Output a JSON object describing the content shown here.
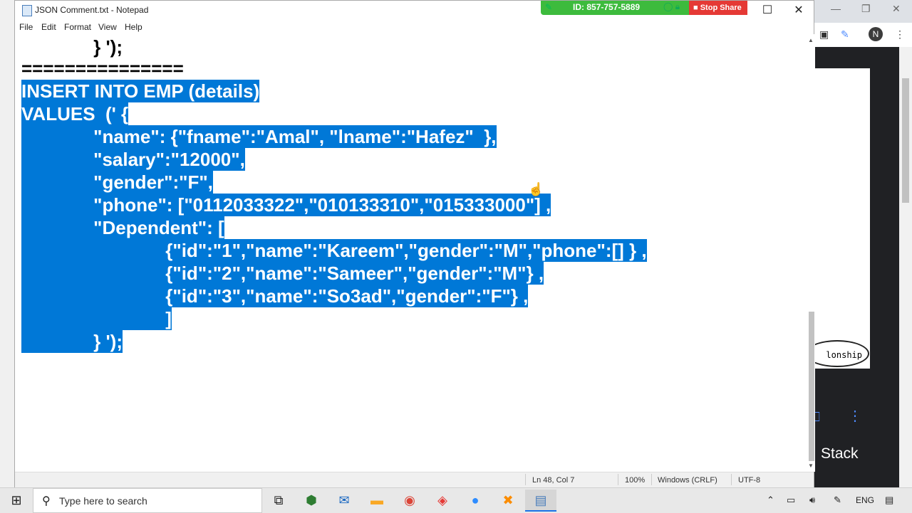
{
  "window": {
    "title": "JSON Comment.txt - Notepad",
    "controls": {
      "minimize": "—",
      "maximize": "☐",
      "close": "✕"
    }
  },
  "share_bar": {
    "id_label": "ID: 857-757-5889",
    "stop_label": "Stop Share",
    "color": "#3dbb3d",
    "stop_color": "#e53935"
  },
  "menu": {
    "items": [
      "File",
      "Edit",
      "Format",
      "View",
      "Help"
    ]
  },
  "editor": {
    "selection_color": "#0078d7",
    "lines": [
      {
        "text": "              } ');",
        "selected": false
      },
      {
        "text": "===============",
        "selected": false
      },
      {
        "text": "INSERT INTO EMP (details)",
        "selected": true
      },
      {
        "text": "VALUES  (' {",
        "selected": true
      },
      {
        "text": "              \"name\": {\"fname\":\"Amal\", \"lname\":\"Hafez\"  },",
        "selected": true
      },
      {
        "text": "              \"salary\":\"12000\",",
        "selected": true
      },
      {
        "text": "              \"gender\":\"F\",",
        "selected": true
      },
      {
        "text": "              \"phone\": [\"0112033322\",\"010133310\",\"015333000\"] ,",
        "selected": true
      },
      {
        "text": "              \"Dependent\": [",
        "selected": true
      },
      {
        "text": "                            {\"id\":\"1\",\"name\":\"Kareem\",\"gender\":\"M\",\"phone\":[] } ,",
        "selected": true
      },
      {
        "text": "                            {\"id\":\"2\",\"name\":\"Sameer\",\"gender\":\"M\"} ,",
        "selected": true
      },
      {
        "text": "                            {\"id\":\"3\",\"name\":\"So3ad\",\"gender\":\"F\"} ,",
        "selected": true
      },
      {
        "text": "                            ]",
        "selected": true
      },
      {
        "text": "              } ');",
        "selected": true
      }
    ]
  },
  "status": {
    "position": "Ln 48, Col 7",
    "zoom": "100%",
    "line_ending": "Windows (CRLF)",
    "encoding": "UTF-8"
  },
  "background": {
    "avatar_letter": "N",
    "partial_label": "lonship",
    "stack_label": "Stack"
  },
  "taskbar": {
    "search_placeholder": "Type here to search",
    "language": "ENG",
    "apps": [
      "task-view-icon",
      "app-icon",
      "mail-icon",
      "file-explorer-icon",
      "chrome-icon",
      "vivaldi-icon",
      "zoom-icon",
      "xampp-icon",
      "notepad-icon"
    ]
  }
}
